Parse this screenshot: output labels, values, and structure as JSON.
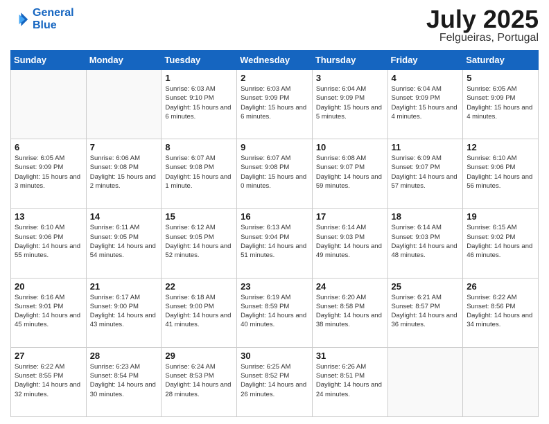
{
  "logo": {
    "line1": "General",
    "line2": "Blue"
  },
  "title": "July 2025",
  "location": "Felgueiras, Portugal",
  "days_header": [
    "Sunday",
    "Monday",
    "Tuesday",
    "Wednesday",
    "Thursday",
    "Friday",
    "Saturday"
  ],
  "weeks": [
    [
      {
        "day": "",
        "info": ""
      },
      {
        "day": "",
        "info": ""
      },
      {
        "day": "1",
        "info": "Sunrise: 6:03 AM\nSunset: 9:10 PM\nDaylight: 15 hours and 6 minutes."
      },
      {
        "day": "2",
        "info": "Sunrise: 6:03 AM\nSunset: 9:09 PM\nDaylight: 15 hours and 6 minutes."
      },
      {
        "day": "3",
        "info": "Sunrise: 6:04 AM\nSunset: 9:09 PM\nDaylight: 15 hours and 5 minutes."
      },
      {
        "day": "4",
        "info": "Sunrise: 6:04 AM\nSunset: 9:09 PM\nDaylight: 15 hours and 4 minutes."
      },
      {
        "day": "5",
        "info": "Sunrise: 6:05 AM\nSunset: 9:09 PM\nDaylight: 15 hours and 4 minutes."
      }
    ],
    [
      {
        "day": "6",
        "info": "Sunrise: 6:05 AM\nSunset: 9:09 PM\nDaylight: 15 hours and 3 minutes."
      },
      {
        "day": "7",
        "info": "Sunrise: 6:06 AM\nSunset: 9:08 PM\nDaylight: 15 hours and 2 minutes."
      },
      {
        "day": "8",
        "info": "Sunrise: 6:07 AM\nSunset: 9:08 PM\nDaylight: 15 hours and 1 minute."
      },
      {
        "day": "9",
        "info": "Sunrise: 6:07 AM\nSunset: 9:08 PM\nDaylight: 15 hours and 0 minutes."
      },
      {
        "day": "10",
        "info": "Sunrise: 6:08 AM\nSunset: 9:07 PM\nDaylight: 14 hours and 59 minutes."
      },
      {
        "day": "11",
        "info": "Sunrise: 6:09 AM\nSunset: 9:07 PM\nDaylight: 14 hours and 57 minutes."
      },
      {
        "day": "12",
        "info": "Sunrise: 6:10 AM\nSunset: 9:06 PM\nDaylight: 14 hours and 56 minutes."
      }
    ],
    [
      {
        "day": "13",
        "info": "Sunrise: 6:10 AM\nSunset: 9:06 PM\nDaylight: 14 hours and 55 minutes."
      },
      {
        "day": "14",
        "info": "Sunrise: 6:11 AM\nSunset: 9:05 PM\nDaylight: 14 hours and 54 minutes."
      },
      {
        "day": "15",
        "info": "Sunrise: 6:12 AM\nSunset: 9:05 PM\nDaylight: 14 hours and 52 minutes."
      },
      {
        "day": "16",
        "info": "Sunrise: 6:13 AM\nSunset: 9:04 PM\nDaylight: 14 hours and 51 minutes."
      },
      {
        "day": "17",
        "info": "Sunrise: 6:14 AM\nSunset: 9:03 PM\nDaylight: 14 hours and 49 minutes."
      },
      {
        "day": "18",
        "info": "Sunrise: 6:14 AM\nSunset: 9:03 PM\nDaylight: 14 hours and 48 minutes."
      },
      {
        "day": "19",
        "info": "Sunrise: 6:15 AM\nSunset: 9:02 PM\nDaylight: 14 hours and 46 minutes."
      }
    ],
    [
      {
        "day": "20",
        "info": "Sunrise: 6:16 AM\nSunset: 9:01 PM\nDaylight: 14 hours and 45 minutes."
      },
      {
        "day": "21",
        "info": "Sunrise: 6:17 AM\nSunset: 9:00 PM\nDaylight: 14 hours and 43 minutes."
      },
      {
        "day": "22",
        "info": "Sunrise: 6:18 AM\nSunset: 9:00 PM\nDaylight: 14 hours and 41 minutes."
      },
      {
        "day": "23",
        "info": "Sunrise: 6:19 AM\nSunset: 8:59 PM\nDaylight: 14 hours and 40 minutes."
      },
      {
        "day": "24",
        "info": "Sunrise: 6:20 AM\nSunset: 8:58 PM\nDaylight: 14 hours and 38 minutes."
      },
      {
        "day": "25",
        "info": "Sunrise: 6:21 AM\nSunset: 8:57 PM\nDaylight: 14 hours and 36 minutes."
      },
      {
        "day": "26",
        "info": "Sunrise: 6:22 AM\nSunset: 8:56 PM\nDaylight: 14 hours and 34 minutes."
      }
    ],
    [
      {
        "day": "27",
        "info": "Sunrise: 6:22 AM\nSunset: 8:55 PM\nDaylight: 14 hours and 32 minutes."
      },
      {
        "day": "28",
        "info": "Sunrise: 6:23 AM\nSunset: 8:54 PM\nDaylight: 14 hours and 30 minutes."
      },
      {
        "day": "29",
        "info": "Sunrise: 6:24 AM\nSunset: 8:53 PM\nDaylight: 14 hours and 28 minutes."
      },
      {
        "day": "30",
        "info": "Sunrise: 6:25 AM\nSunset: 8:52 PM\nDaylight: 14 hours and 26 minutes."
      },
      {
        "day": "31",
        "info": "Sunrise: 6:26 AM\nSunset: 8:51 PM\nDaylight: 14 hours and 24 minutes."
      },
      {
        "day": "",
        "info": ""
      },
      {
        "day": "",
        "info": ""
      }
    ]
  ]
}
